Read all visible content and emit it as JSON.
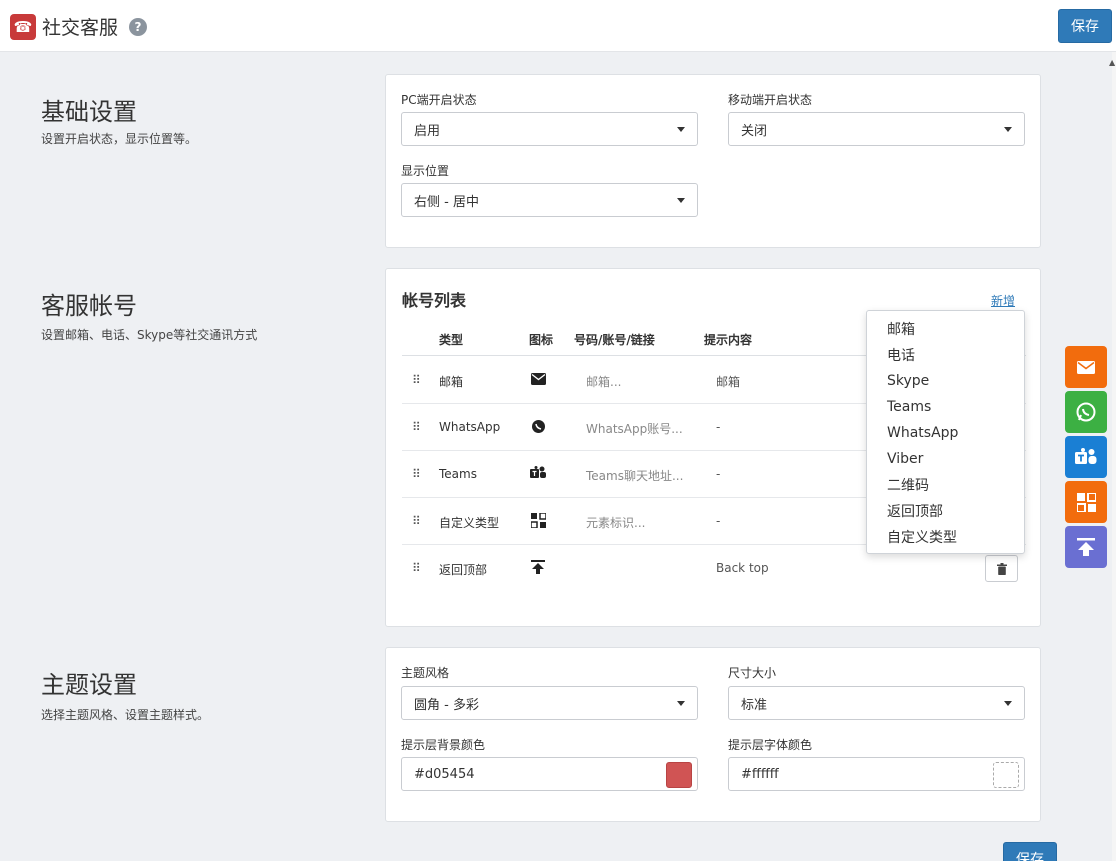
{
  "header": {
    "title": "社交客服",
    "help": "?",
    "save_label": "保存"
  },
  "sections": {
    "basic": {
      "title": "基础设置",
      "desc": "设置开启状态，显示位置等。"
    },
    "accounts": {
      "title": "客服帐号",
      "desc": "设置邮箱、电话、Skype等社交通讯方式"
    },
    "theme": {
      "title": "主题设置",
      "desc": "选择主题风格、设置主题样式。"
    }
  },
  "basic_settings": {
    "pc_label": "PC端开启状态",
    "pc_value": "启用",
    "mobile_label": "移动端开启状态",
    "mobile_value": "关闭",
    "position_label": "显示位置",
    "position_value": "右侧 - 居中"
  },
  "account_list": {
    "title": "帐号列表",
    "add_label": "新增",
    "columns": {
      "type": "类型",
      "icon": "图标",
      "account": "号码/账号/链接",
      "tip": "提示内容"
    },
    "rows": [
      {
        "type": "邮箱",
        "icon": "envelope-icon",
        "account_placeholder": "邮箱...",
        "tip": "邮箱"
      },
      {
        "type": "WhatsApp",
        "icon": "whatsapp-icon",
        "account_placeholder": "WhatsApp账号...",
        "tip": "-"
      },
      {
        "type": "Teams",
        "icon": "teams-icon",
        "account_placeholder": "Teams聊天地址...",
        "tip": "-"
      },
      {
        "type": "自定义类型",
        "icon": "qrcode-icon",
        "account_placeholder": "元素标识...",
        "tip": "-"
      },
      {
        "type": "返回顶部",
        "icon": "back-top-icon",
        "account_placeholder": "",
        "tip": "Back top"
      }
    ],
    "menu": [
      "邮箱",
      "电话",
      "Skype",
      "Teams",
      "WhatsApp",
      "Viber",
      "二维码",
      "返回顶部",
      "自定义类型"
    ]
  },
  "theme_settings": {
    "style_label": "主题风格",
    "style_value": "圆角 - 多彩",
    "size_label": "尺寸大小",
    "size_value": "标准",
    "tip_bg_label": "提示层背景颜色",
    "tip_bg_value": "#d05454",
    "tip_font_label": "提示层字体颜色",
    "tip_font_value": "#ffffff"
  },
  "floating_buttons": [
    {
      "name": "email",
      "icon": "envelope-icon",
      "color": "#f26c0d"
    },
    {
      "name": "whatsapp",
      "icon": "whatsapp-icon",
      "color": "#3cb043"
    },
    {
      "name": "teams",
      "icon": "teams-icon",
      "color": "#1a7fd4"
    },
    {
      "name": "custom",
      "icon": "qrcode-icon",
      "color": "#f26c0d"
    },
    {
      "name": "back-top",
      "icon": "back-top-icon",
      "color": "#6a6fd2"
    }
  ]
}
